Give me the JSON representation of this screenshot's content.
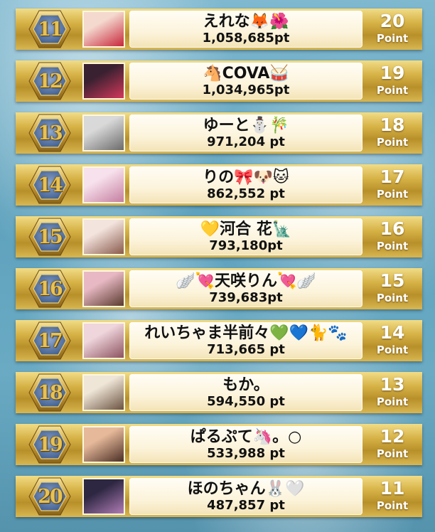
{
  "colors": {
    "gold_light": "#f1dc86",
    "gold_dark": "#b8902a",
    "hex_blue": "#5a78a6",
    "rank_text": "#e7c254",
    "panel": "#fcf3da"
  },
  "ranking": [
    {
      "rank": "11",
      "name": "えれな🦊🌺",
      "score": "1,058,685pt",
      "points": "20",
      "points_label": "Point",
      "avatar_colors": [
        "#f4d9cf",
        "#c7263a"
      ]
    },
    {
      "rank": "12",
      "name": "🐴COVA🥁",
      "score": "1,034,965pt",
      "points": "19",
      "points_label": "Point",
      "avatar_colors": [
        "#3a2131",
        "#d3385b"
      ]
    },
    {
      "rank": "13",
      "name": "ゆーと⛄🎋",
      "score": "971,204 pt",
      "points": "18",
      "points_label": "Point",
      "avatar_colors": [
        "#d9d9d9",
        "#6b6b6b"
      ]
    },
    {
      "rank": "14",
      "name": "りの🎀🐶🐱",
      "score": "862,552 pt",
      "points": "17",
      "points_label": "Point",
      "avatar_colors": [
        "#f7e1ec",
        "#c57ea0"
      ]
    },
    {
      "rank": "15",
      "name": "💛河合 花🗽",
      "score": "793,180pt",
      "points": "16",
      "points_label": "Point",
      "avatar_colors": [
        "#f3e4de",
        "#8a5a4c"
      ]
    },
    {
      "rank": "16",
      "name": "🪽💘天咲りん💘🪽",
      "score": "739,683pt",
      "points": "15",
      "points_label": "Point",
      "avatar_colors": [
        "#e8b9c4",
        "#5a3a2e"
      ]
    },
    {
      "rank": "17",
      "name": "れいちゃま半前々💚💙🐈🐾",
      "score": "713,665 pt",
      "points": "14",
      "points_label": "Point",
      "avatar_colors": [
        "#efd5dc",
        "#8c5360"
      ]
    },
    {
      "rank": "18",
      "name": "もか。",
      "score": "594,550 pt",
      "points": "13",
      "points_label": "Point",
      "avatar_colors": [
        "#efe6d8",
        "#6b5240"
      ]
    },
    {
      "rank": "19",
      "name": "ぱるぷて🦄。○",
      "score": "533,988 pt",
      "points": "12",
      "points_label": "Point",
      "avatar_colors": [
        "#e6b99a",
        "#4a2e25"
      ]
    },
    {
      "rank": "20",
      "name": "ほのちゃん🐰🤍",
      "score": "487,857 pt",
      "points": "11",
      "points_label": "Point",
      "avatar_colors": [
        "#2d2742",
        "#b07cb5"
      ]
    }
  ]
}
